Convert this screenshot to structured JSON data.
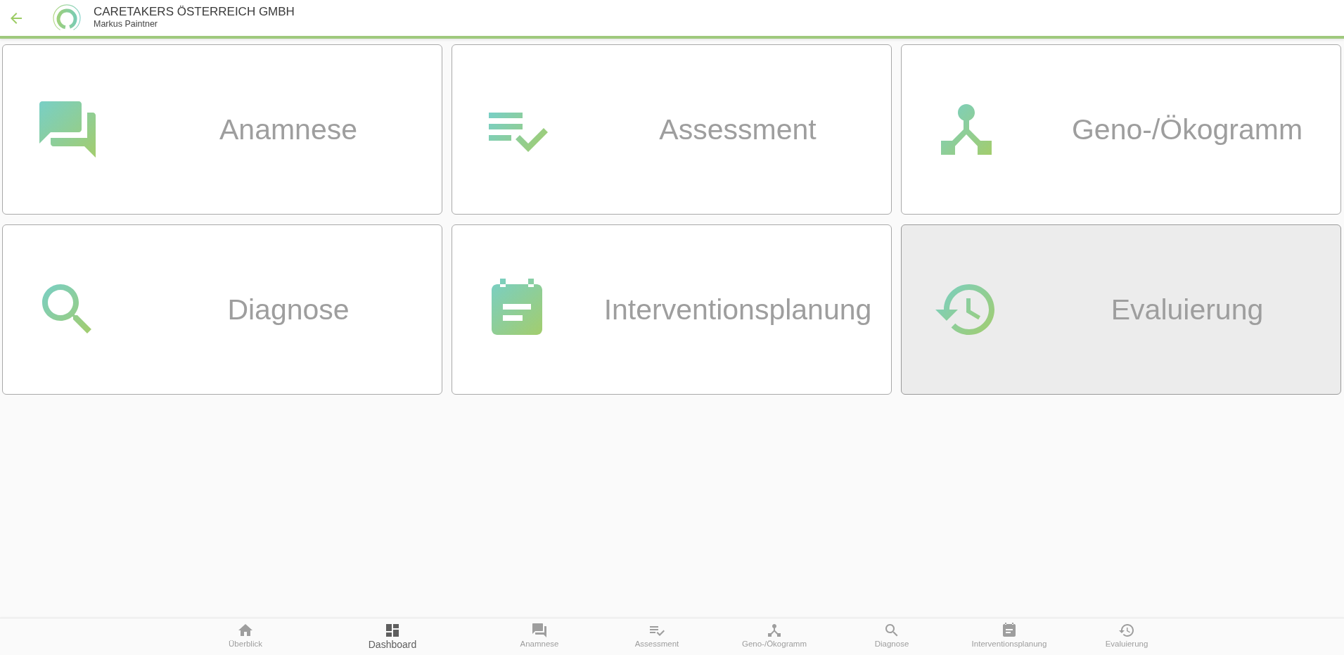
{
  "header": {
    "title": "CARETAKERS ÖSTERREICH GMBH",
    "subtitle": "Markus Paintner"
  },
  "tiles": [
    {
      "label": "Anamnese",
      "kind": "chat",
      "highlighted": false
    },
    {
      "label": "Assessment",
      "kind": "checklist",
      "highlighted": false
    },
    {
      "label": "Geno-/Ökogramm",
      "kind": "hub",
      "highlighted": false
    },
    {
      "label": "Diagnose",
      "kind": "search",
      "highlighted": false
    },
    {
      "label": "Interventionsplanung",
      "kind": "calendar",
      "highlighted": false
    },
    {
      "label": "Evaluierung",
      "kind": "history",
      "highlighted": true
    }
  ],
  "bottom_nav": [
    {
      "label": "Überblick",
      "kind": "home",
      "selected": false
    },
    {
      "label": "Dashboard",
      "kind": "dashboard",
      "selected": true
    },
    {
      "label": "Anamnese",
      "kind": "chat",
      "selected": false
    },
    {
      "label": "Assessment",
      "kind": "checklist",
      "selected": false
    },
    {
      "label": "Geno-/Ökogramm",
      "kind": "hub",
      "selected": false
    },
    {
      "label": "Diagnose",
      "kind": "search",
      "selected": false
    },
    {
      "label": "Interventionsplanung",
      "kind": "calendar",
      "selected": false
    },
    {
      "label": "Evaluierung",
      "kind": "history",
      "selected": false
    }
  ]
}
